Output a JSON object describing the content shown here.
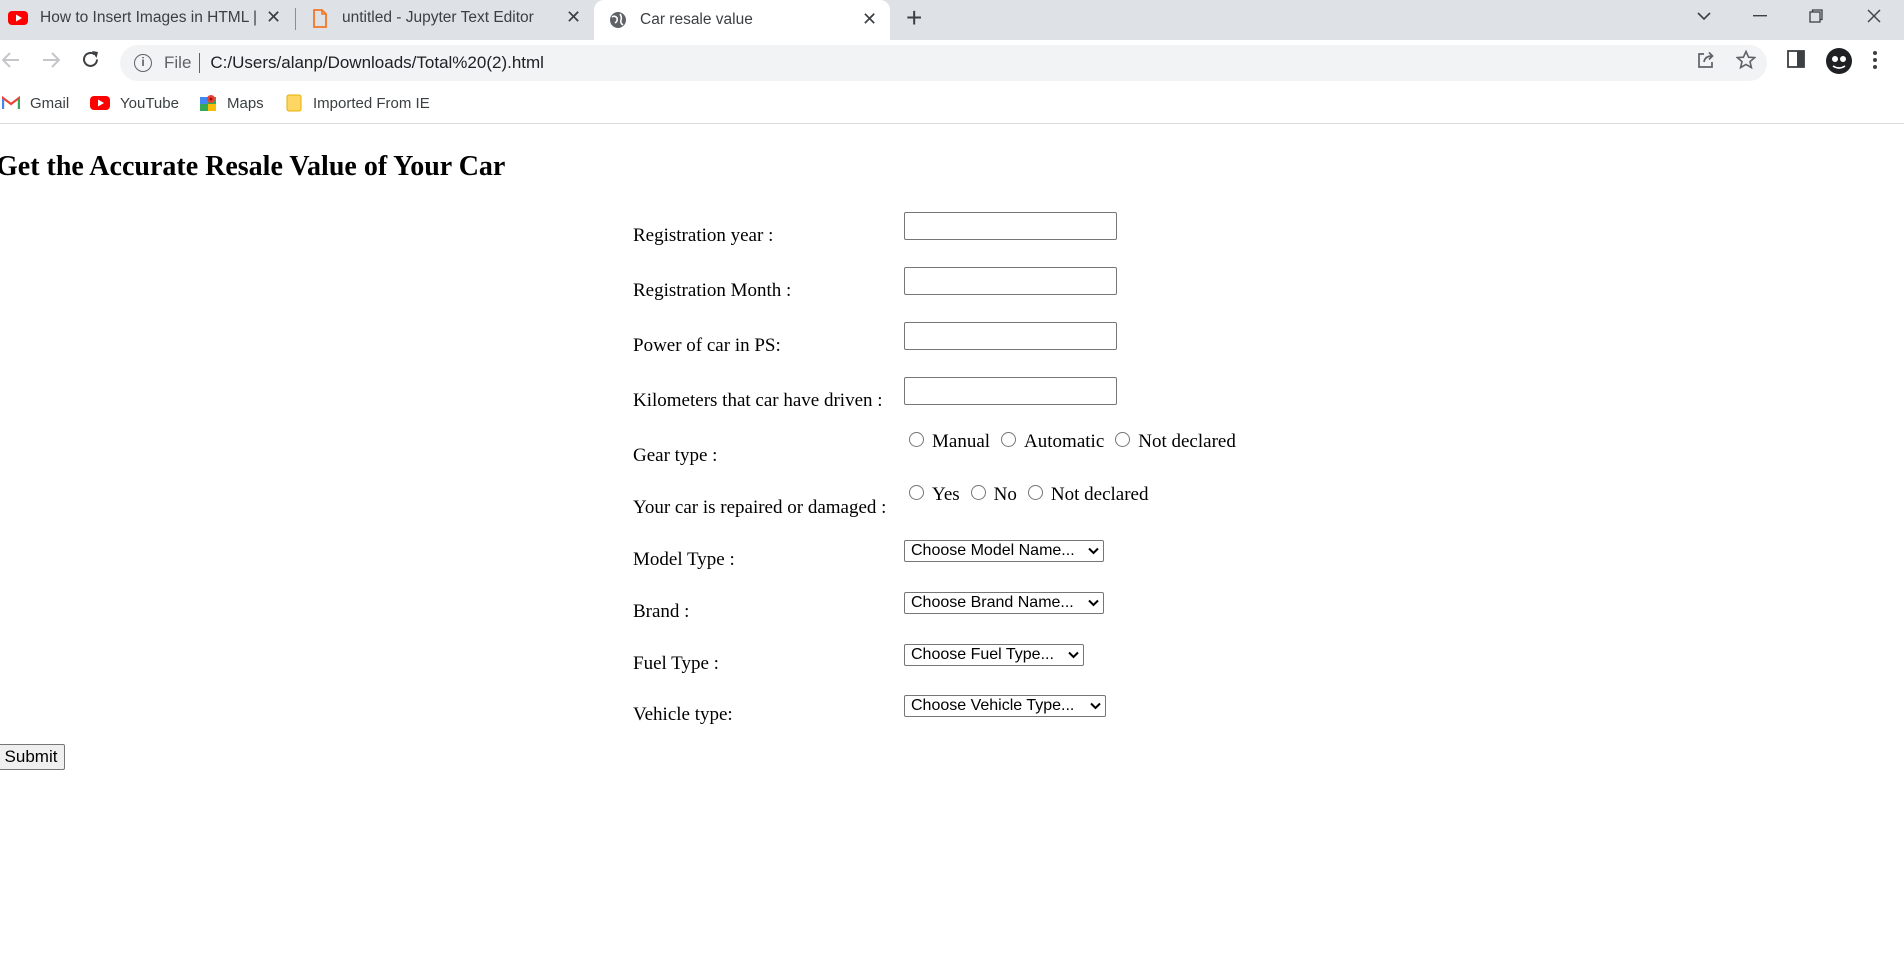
{
  "browser": {
    "tabs": [
      {
        "title": "How to Insert Images in HTML | A",
        "icon": "youtube-icon",
        "active": false
      },
      {
        "title": "untitled - Jupyter Text Editor",
        "icon": "file-icon",
        "active": false
      },
      {
        "title": "Car resale value",
        "icon": "globe-icon",
        "active": true
      }
    ],
    "omnibox": {
      "scheme": "File",
      "url": "C:/Users/alanp/Downloads/Total%20(2).html"
    },
    "bookmarks": [
      {
        "label": "Gmail",
        "icon": "gmail-icon"
      },
      {
        "label": "YouTube",
        "icon": "youtube-icon"
      },
      {
        "label": "Maps",
        "icon": "maps-icon"
      },
      {
        "label": "Imported From IE",
        "icon": "folder-icon"
      }
    ]
  },
  "page": {
    "title": "Get the Accurate Resale Value of Your Car",
    "fields": {
      "registration_year": {
        "label": "Registration year :",
        "value": ""
      },
      "registration_month": {
        "label": "Registration Month :",
        "value": ""
      },
      "power": {
        "label": "Power of car in PS:",
        "value": ""
      },
      "kilometers": {
        "label": "Kilometers that car have driven :",
        "value": ""
      }
    },
    "gear": {
      "label": "Gear type :",
      "options": [
        "Manual",
        "Automatic",
        "Not declared"
      ]
    },
    "damage": {
      "label": "Your car is repaired or damaged :",
      "options": [
        "Yes",
        "No",
        "Not declared"
      ]
    },
    "model": {
      "label": "Model Type :",
      "selected": "Choose Model Name..."
    },
    "brand": {
      "label": "Brand :",
      "selected": "Choose Brand Name..."
    },
    "fuel": {
      "label": "Fuel Type :",
      "selected": "Choose Fuel Type..."
    },
    "vehicle": {
      "label": "Vehicle type:",
      "selected": "Choose Vehicle Type..."
    },
    "submit_label": "Submit"
  }
}
